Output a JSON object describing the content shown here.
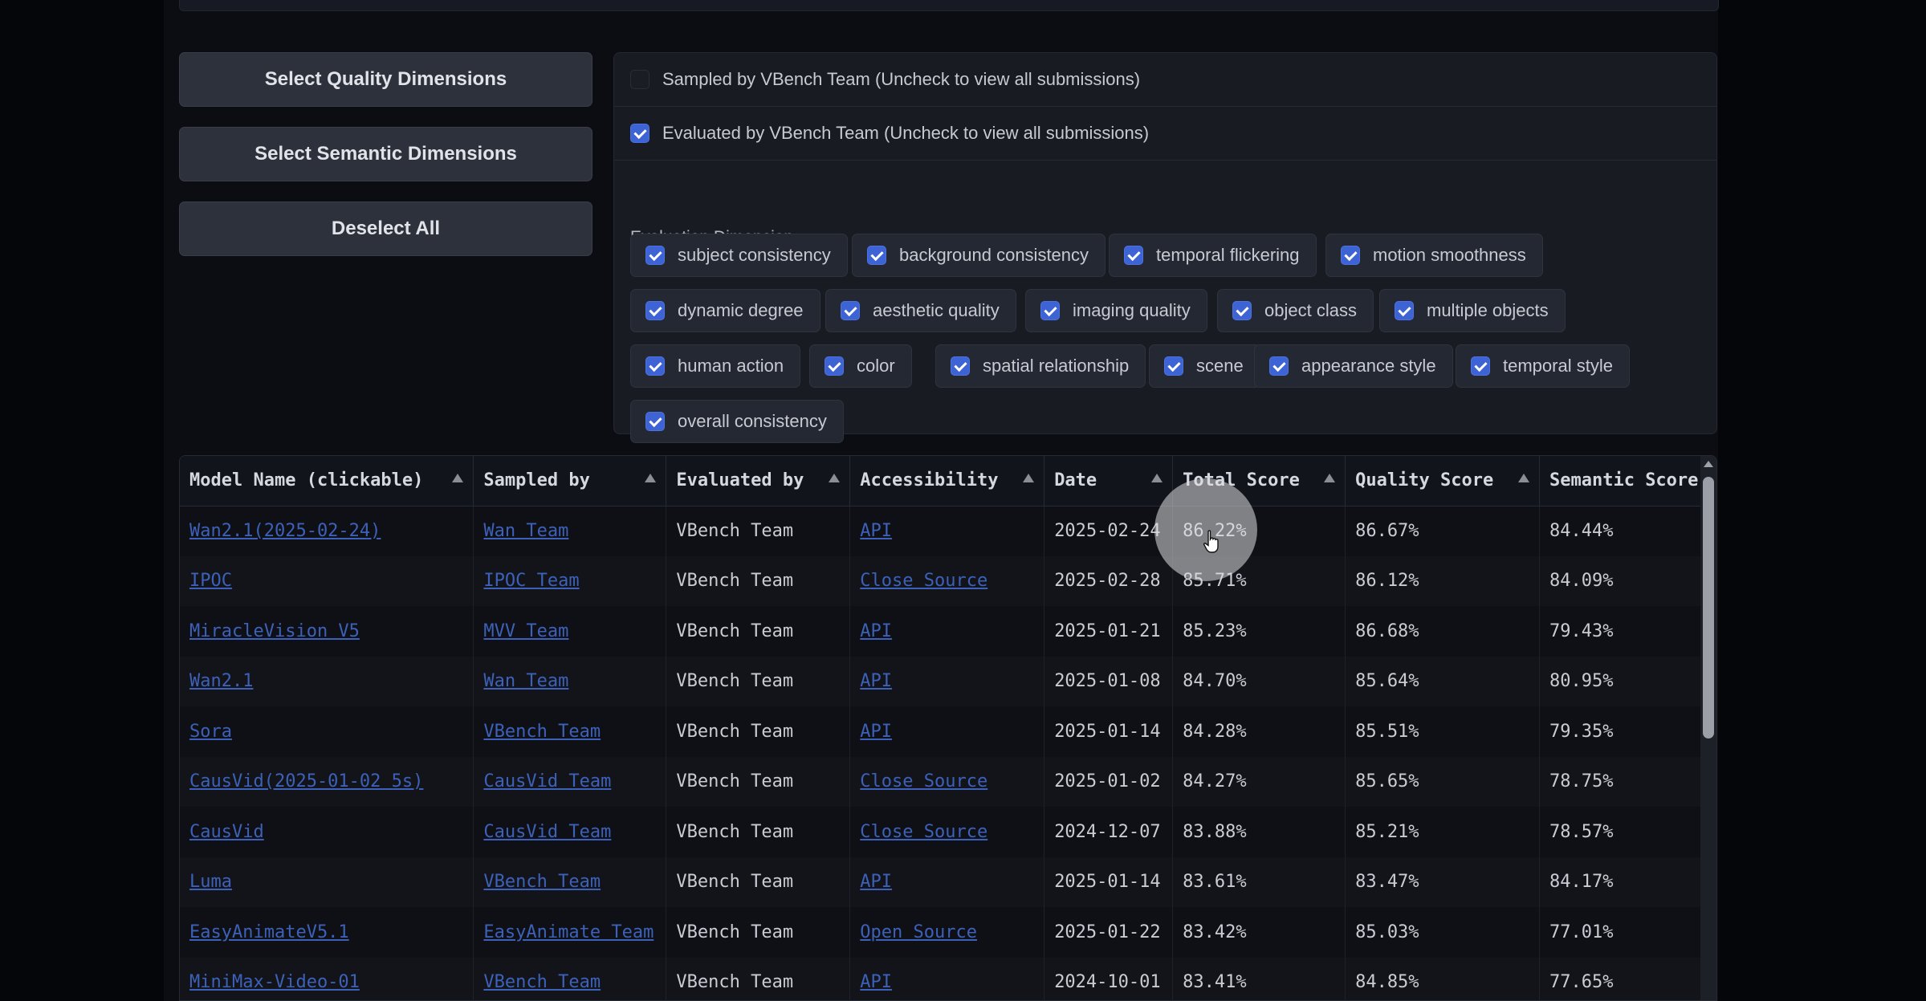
{
  "buttons": {
    "quality": "Select Quality Dimensions",
    "semantic": "Select Semantic Dimensions",
    "deselect": "Deselect All"
  },
  "filters": {
    "sampled_by_vbench": "Sampled by VBench Team (Uncheck to view all submissions)",
    "sampled_checked": false,
    "evaluated_by_vbench": "Evaluated by VBench Team (Uncheck to view all submissions)",
    "evaluated_checked": true
  },
  "dimensions": {
    "label": "Evaluation Dimension",
    "items": [
      {
        "label": "subject consistency",
        "checked": true
      },
      {
        "label": "background consistency",
        "checked": true
      },
      {
        "label": "temporal flickering",
        "checked": true
      },
      {
        "label": "motion smoothness",
        "checked": true
      },
      {
        "label": "dynamic degree",
        "checked": true
      },
      {
        "label": "aesthetic quality",
        "checked": true
      },
      {
        "label": "imaging quality",
        "checked": true
      },
      {
        "label": "object class",
        "checked": true
      },
      {
        "label": "multiple objects",
        "checked": true
      },
      {
        "label": "human action",
        "checked": true
      },
      {
        "label": "color",
        "checked": true
      },
      {
        "label": "spatial relationship",
        "checked": true
      },
      {
        "label": "scene",
        "checked": true
      },
      {
        "label": "appearance style",
        "checked": true
      },
      {
        "label": "temporal style",
        "checked": true
      },
      {
        "label": "overall consistency",
        "checked": true
      }
    ]
  },
  "table": {
    "headers": [
      "Model Name (clickable)",
      "Sampled by",
      "Evaluated by",
      "Accessibility",
      "Date",
      "Total Score",
      "Quality Score",
      "Semantic Score"
    ],
    "rows": [
      [
        "Wan2.1(2025-02-24)",
        "Wan Team",
        "VBench Team",
        "API",
        "2025-02-24",
        "86.22%",
        "86.67%",
        "84.44%"
      ],
      [
        "IPOC",
        "IPOC Team",
        "VBench Team",
        "Close Source",
        "2025-02-28",
        "85.71%",
        "86.12%",
        "84.09%"
      ],
      [
        "MiracleVision V5",
        "MVV Team",
        "VBench Team",
        "API",
        "2025-01-21",
        "85.23%",
        "86.68%",
        "79.43%"
      ],
      [
        "Wan2.1",
        "Wan Team",
        "VBench Team",
        "API",
        "2025-01-08",
        "84.70%",
        "85.64%",
        "80.95%"
      ],
      [
        "Sora",
        "VBench Team",
        "VBench Team",
        "API",
        "2025-01-14",
        "84.28%",
        "85.51%",
        "79.35%"
      ],
      [
        "CausVid(2025-01-02 5s)",
        "CausVid Team",
        "VBench Team",
        "Close Source",
        "2025-01-02",
        "84.27%",
        "85.65%",
        "78.75%"
      ],
      [
        "CausVid",
        "CausVid Team",
        "VBench Team",
        "Close Source",
        "2024-12-07",
        "83.88%",
        "85.21%",
        "78.57%"
      ],
      [
        "Luma",
        "VBench Team",
        "VBench Team",
        "API",
        "2025-01-14",
        "83.61%",
        "83.47%",
        "84.17%"
      ],
      [
        "EasyAnimateV5.1",
        "EasyAnimate Team",
        "VBench Team",
        "Open Source",
        "2025-01-22",
        "83.42%",
        "85.03%",
        "77.01%"
      ],
      [
        "MiniMax-Video-01",
        "VBench Team",
        "VBench Team",
        "API",
        "2024-10-01",
        "83.41%",
        "84.85%",
        "77.65%"
      ]
    ]
  },
  "colors": {
    "link": "#3d61b8",
    "checkbox": "#3d63d4",
    "background": "#050609"
  }
}
